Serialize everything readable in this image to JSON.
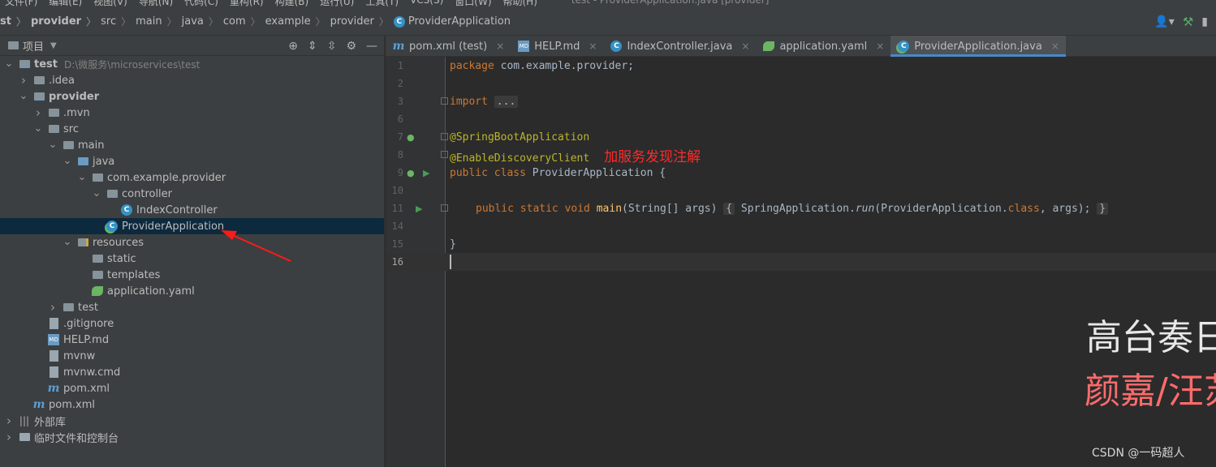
{
  "menubar": {
    "items": [
      "文件(F)",
      "编辑(E)",
      "视图(V)",
      "导航(N)",
      "代码(C)",
      "重构(R)",
      "构建(B)",
      "运行(U)",
      "工具(T)",
      "VCS(S)",
      "窗口(W)",
      "帮助(H)"
    ],
    "window_title": "test - ProviderApplication.java [provider]"
  },
  "breadcrumb": [
    "st",
    "provider",
    "src",
    "main",
    "java",
    "com",
    "example",
    "provider",
    "ProviderApplication"
  ],
  "project_panel": {
    "title": "项目",
    "tree": [
      {
        "label": "test",
        "extra": "D:\\微服务\\microservices\\test",
        "depth": 0,
        "expanded": true,
        "icon": "module-folder-icon",
        "bold": true
      },
      {
        "label": ".idea",
        "depth": 1,
        "expanded": false,
        "icon": "folder-icon"
      },
      {
        "label": "provider",
        "depth": 1,
        "expanded": true,
        "icon": "module-folder-icon",
        "bold": true
      },
      {
        "label": ".mvn",
        "depth": 2,
        "expanded": false,
        "icon": "folder-icon"
      },
      {
        "label": "src",
        "depth": 2,
        "expanded": true,
        "icon": "folder-icon"
      },
      {
        "label": "main",
        "depth": 3,
        "expanded": true,
        "icon": "folder-icon"
      },
      {
        "label": "java",
        "depth": 4,
        "expanded": true,
        "icon": "source-folder-icon"
      },
      {
        "label": "com.example.provider",
        "depth": 5,
        "expanded": true,
        "icon": "package-icon"
      },
      {
        "label": "controller",
        "depth": 6,
        "expanded": true,
        "icon": "package-icon"
      },
      {
        "label": "IndexController",
        "depth": 7,
        "icon": "class-icon"
      },
      {
        "label": "ProviderApplication",
        "depth": 6,
        "icon": "spring-class-icon",
        "selected": true
      },
      {
        "label": "resources",
        "depth": 4,
        "expanded": true,
        "icon": "resources-folder-icon"
      },
      {
        "label": "static",
        "depth": 5,
        "icon": "folder-icon"
      },
      {
        "label": "templates",
        "depth": 5,
        "icon": "folder-icon"
      },
      {
        "label": "application.yaml",
        "depth": 5,
        "icon": "spring-config-icon"
      },
      {
        "label": "test",
        "depth": 3,
        "expanded": false,
        "icon": "folder-icon"
      },
      {
        "label": ".gitignore",
        "depth": 2,
        "icon": "text-file-icon"
      },
      {
        "label": "HELP.md",
        "depth": 2,
        "icon": "markdown-file-icon"
      },
      {
        "label": "mvnw",
        "depth": 2,
        "icon": "text-file-icon"
      },
      {
        "label": "mvnw.cmd",
        "depth": 2,
        "icon": "text-file-icon"
      },
      {
        "label": "pom.xml",
        "depth": 2,
        "icon": "maven-file-icon"
      },
      {
        "label": "pom.xml",
        "depth": 1,
        "icon": "maven-file-icon"
      },
      {
        "label": "外部库",
        "depth": 0,
        "expanded": false,
        "icon": "libraries-icon"
      },
      {
        "label": "临时文件和控制台",
        "depth": 0,
        "expanded": false,
        "icon": "scratches-icon"
      }
    ]
  },
  "editor_tabs": [
    {
      "label": "pom.xml (test)",
      "icon": "maven-file-icon"
    },
    {
      "label": "HELP.md",
      "icon": "markdown-file-icon"
    },
    {
      "label": "IndexController.java",
      "icon": "class-icon"
    },
    {
      "label": "application.yaml",
      "icon": "spring-config-icon"
    },
    {
      "label": "ProviderApplication.java",
      "icon": "spring-class-icon",
      "active": true
    }
  ],
  "code": {
    "line_numbers": [
      "1",
      "2",
      "3",
      "6",
      "7",
      "8",
      "9",
      "10",
      "11",
      "14",
      "15",
      "16"
    ],
    "l1_kw": "package",
    "l1_rest": " com.example.provider;",
    "l3_kw": "import",
    "l3_fold": "...",
    "l7_ann": "@SpringBootApplication",
    "l8_ann": "@EnableDiscoveryClient",
    "l8_note": "加服务发现注解",
    "l9_kw": "public class",
    "l9_rest": " ProviderApplication {",
    "l11_kw": "public static void",
    "l11_fn": "main",
    "l11_args": "(String[] args)",
    "l11_fold_open": "{",
    "l11_body1": " SpringApplication.",
    "l11_run": "run",
    "l11_body2": "(ProviderApplication.",
    "l11_class_kw": "class",
    "l11_body3": ", args);",
    "l11_fold_close": "}",
    "l15": "}"
  },
  "overlay": {
    "line1": "高台奏日",
    "line2": "颜嘉/汪苏",
    "watermark": "CSDN @一码超人"
  }
}
